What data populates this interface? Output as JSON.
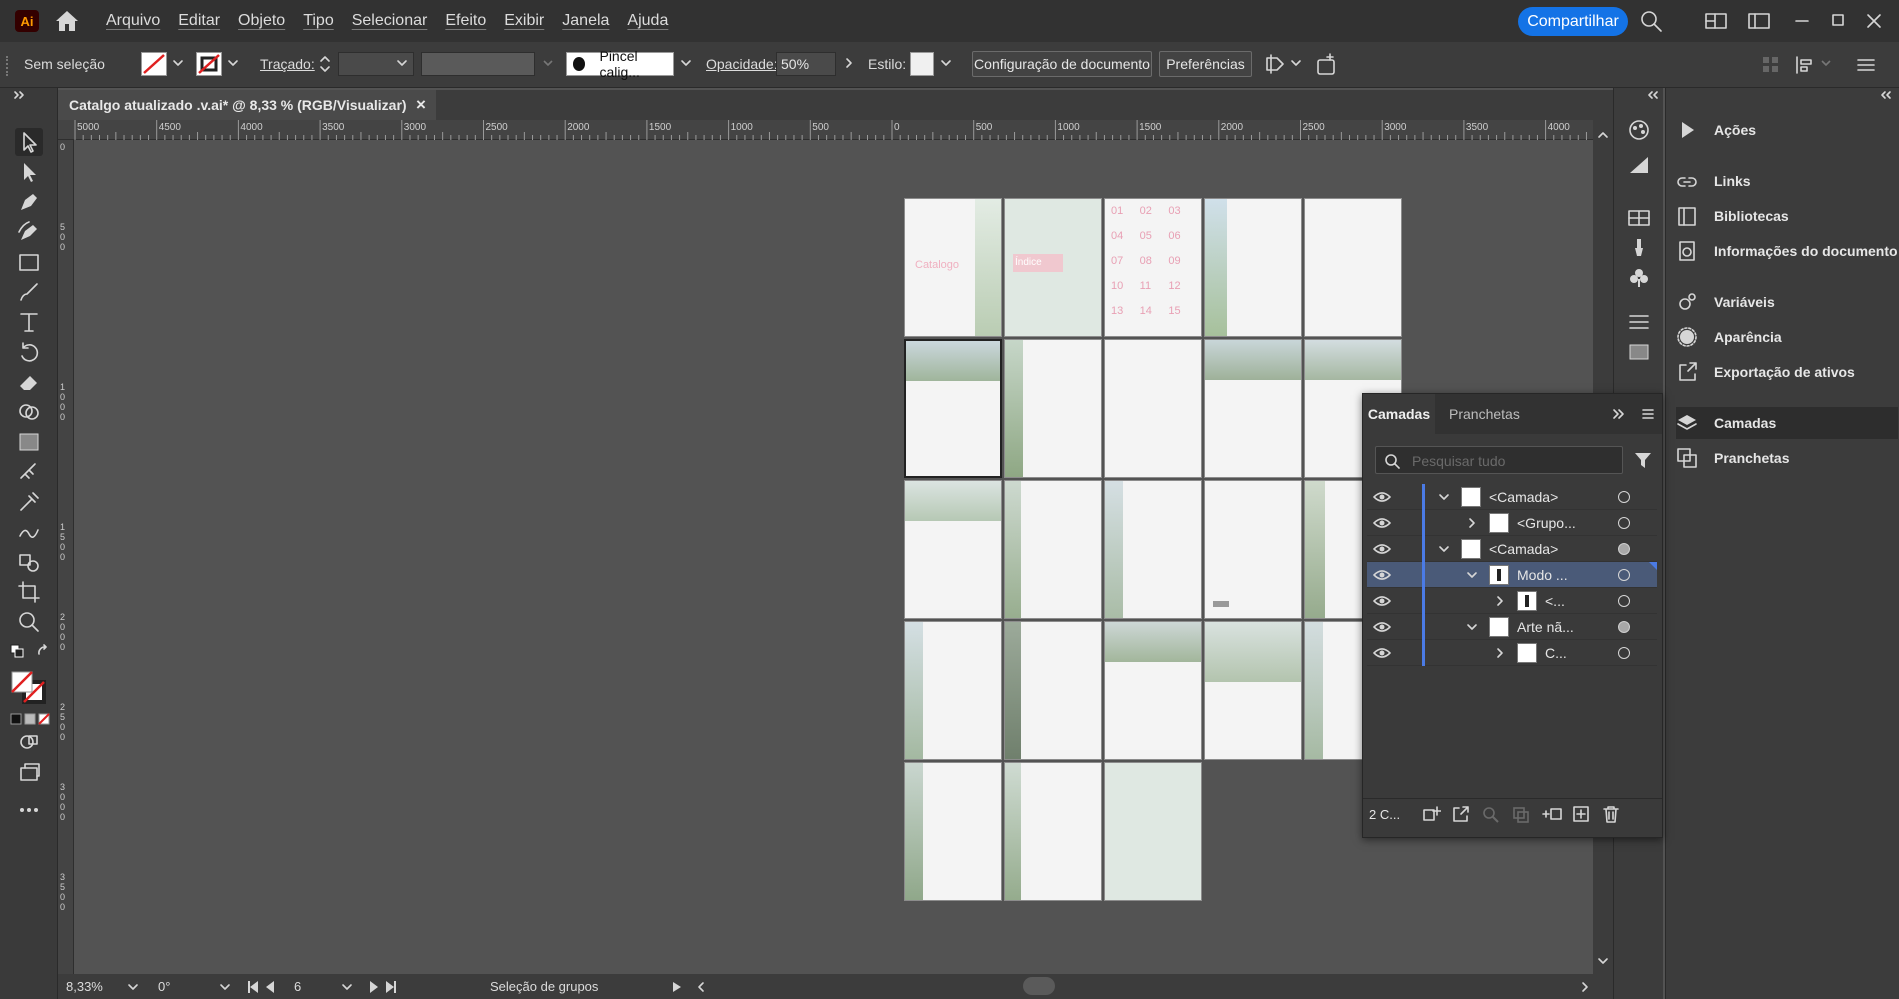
{
  "app": {
    "logo_text": "Ai"
  },
  "menu": [
    "Arquivo",
    "Editar",
    "Objeto",
    "Tipo",
    "Selecionar",
    "Efeito",
    "Exibir",
    "Janela",
    "Ajuda"
  ],
  "header": {
    "share_label": "Compartilhar"
  },
  "control_bar": {
    "selection": "Sem seleção",
    "stroke_label": "Traçado:",
    "brush": "Pincel calig...",
    "opacity_label": "Opacidade:",
    "opacity_value": "50%",
    "style_label": "Estilo:",
    "doc_setup": "Configuração de documento",
    "preferences": "Preferências"
  },
  "document": {
    "tab_title": "Catalgo atualizado .v.ai* @ 8,33 % (RGB/Visualizar)",
    "close": "×"
  },
  "ruler": {
    "ticks": [
      "5000",
      "4500",
      "4000",
      "3500",
      "3000",
      "2500",
      "2000",
      "1500",
      "1000",
      "500",
      "0",
      "500",
      "1000",
      "1500",
      "2000",
      "2500",
      "3000",
      "3500",
      "4000"
    ]
  },
  "artboard_text": {
    "cover_title": "Catalogo",
    "page2_title": "Índice",
    "index_numbers": [
      "01",
      "02",
      "03",
      "04",
      "05",
      "06",
      "07",
      "08",
      "09",
      "10",
      "11",
      "12",
      "13",
      "14",
      "15"
    ]
  },
  "status": {
    "zoom": "8,33%",
    "rotation": "0°",
    "artboard": "6",
    "tool": "Seleção de grupos"
  },
  "right_panel": {
    "items": [
      "Ações",
      "Links",
      "Bibliotecas",
      "Informações do documento",
      "Variáveis",
      "Aparência",
      "Exportação de ativos",
      "Camadas",
      "Pranchetas"
    ]
  },
  "layers_panel": {
    "tabs": [
      "Camadas",
      "Pranchetas"
    ],
    "search_placeholder": "Pesquisar tudo",
    "rows": [
      "<Camada>",
      "<Grupo...",
      "<Camada>",
      "Modo ...",
      "<...",
      "Arte nã...",
      "C..."
    ],
    "footer_count": "2 C..."
  },
  "colors": {
    "accent": "#1473e6",
    "selection": "#4a5a78",
    "layer_bar": "#4b7be5"
  }
}
